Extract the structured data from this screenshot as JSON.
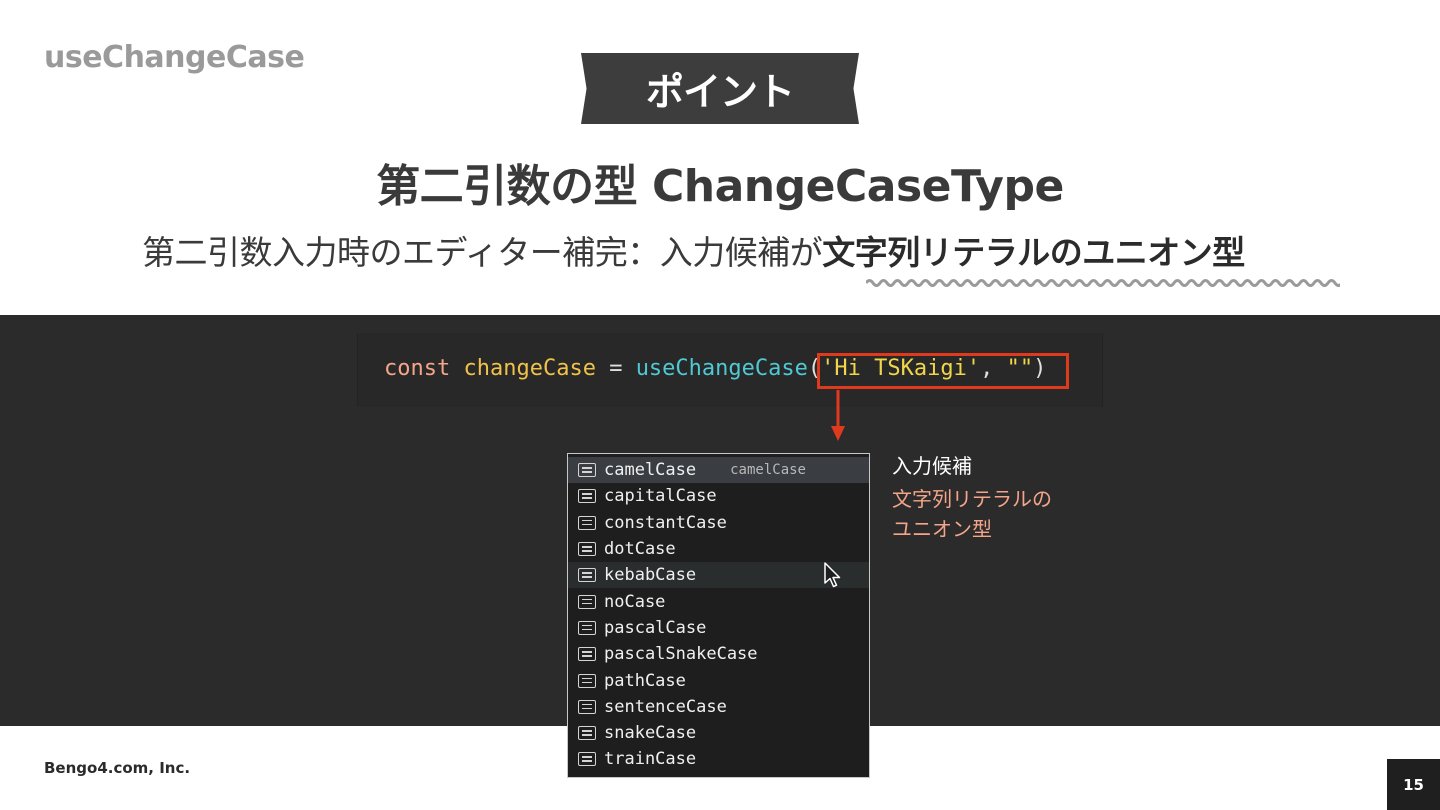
{
  "deck_title": "useChangeCase",
  "banner": "ポイント",
  "heading": "第二引数の型 ChangeCaseType",
  "subheading": {
    "plain": "第二引数入力時のエディター補完：入力候補が",
    "emphasis": "文字列リテラルのユニオン型"
  },
  "code": {
    "keyword": "const",
    "variable": "changeCase",
    "operator": "=",
    "function": "useChangeCase",
    "open_paren": "(",
    "string1": "'Hi TSKaigi'",
    "comma": ",",
    "string2": "\"\"",
    "close_paren": ")"
  },
  "suggestions": {
    "items": [
      {
        "label": "camelCase",
        "detail": "camelCase"
      },
      {
        "label": "capitalCase"
      },
      {
        "label": "constantCase"
      },
      {
        "label": "dotCase"
      },
      {
        "label": "kebabCase"
      },
      {
        "label": "noCase"
      },
      {
        "label": "pascalCase"
      },
      {
        "label": "pascalSnakeCase"
      },
      {
        "label": "pathCase"
      },
      {
        "label": "sentenceCase"
      },
      {
        "label": "snakeCase"
      },
      {
        "label": "trainCase"
      }
    ],
    "item_icon": "text-icon"
  },
  "note": {
    "label": "入力候補",
    "accent_line1": "文字列リテラルの",
    "accent_line2": "ユニオン型"
  },
  "footer": {
    "company": "Bengo4.com, Inc.",
    "page": "15"
  },
  "colors": {
    "highlight_border": "#e03a1e",
    "accent": "#f4a58a",
    "dark_band": "#2b2b2b"
  }
}
